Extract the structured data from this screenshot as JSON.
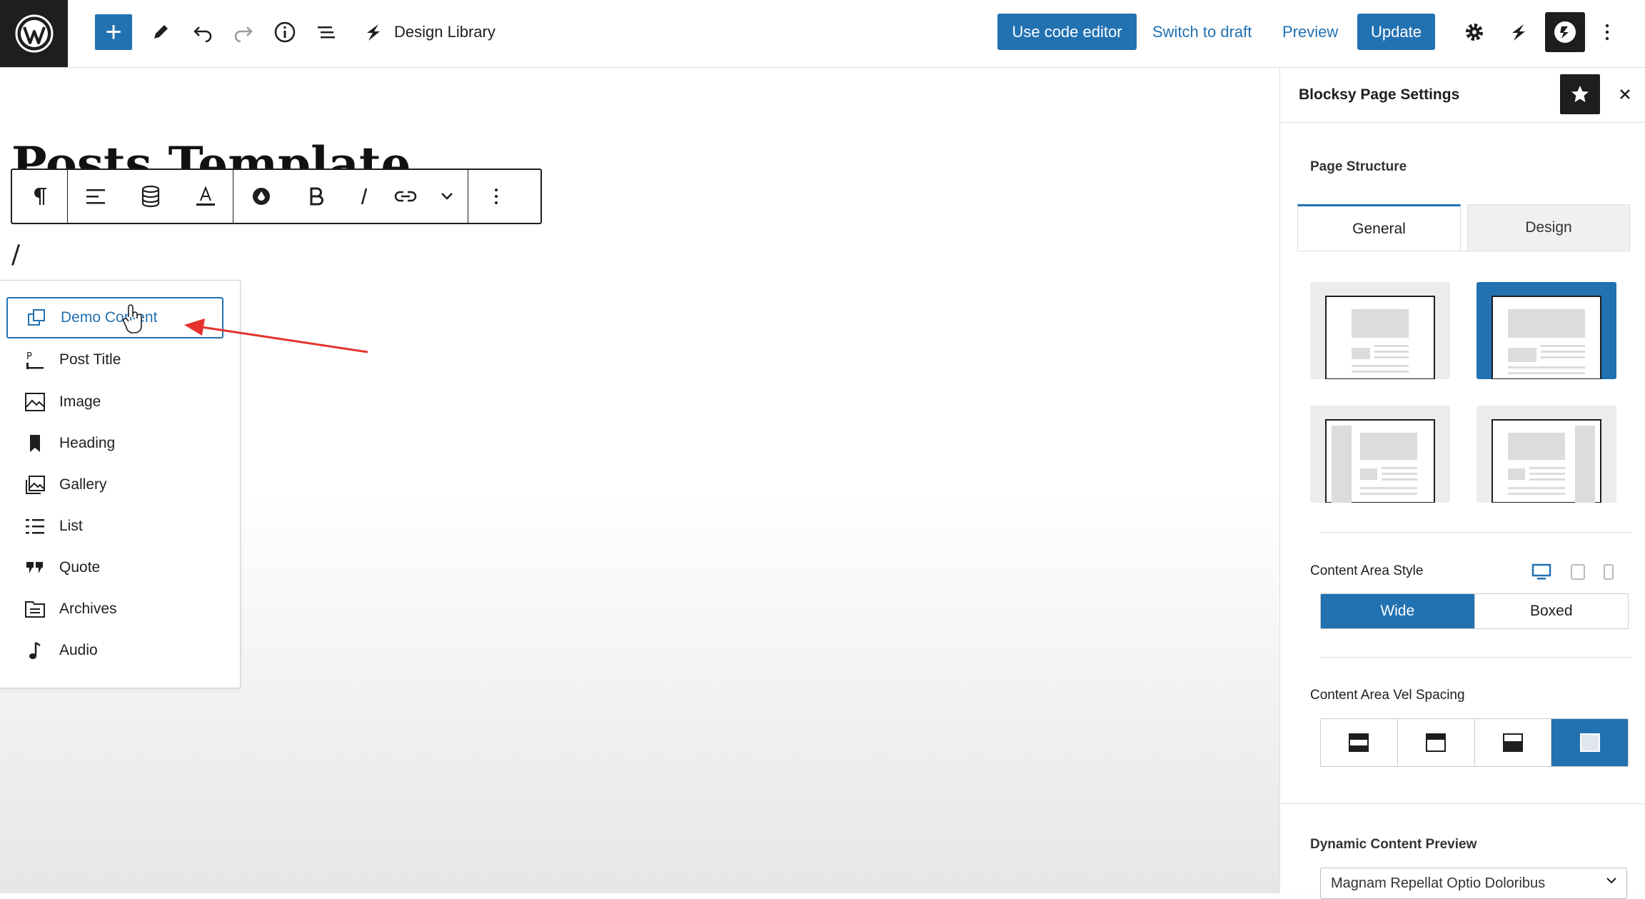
{
  "topbar": {
    "design_library_label": "Design Library",
    "code_editor_label": "Use code editor",
    "switch_draft_label": "Switch to draft",
    "preview_label": "Preview",
    "update_label": "Update",
    "accent_color": "#2271b1"
  },
  "editor": {
    "post_title": "Posts Template",
    "slash_input": "/",
    "toolbar": [
      "paragraph-icon",
      "align-icon",
      "database-icon",
      "text-color-icon",
      "highlight-icon",
      "bold-icon",
      "italic-icon",
      "link-icon",
      "more-chevron-icon",
      "options-icon"
    ]
  },
  "inserter": {
    "items": [
      {
        "label": "Demo Content",
        "icon": "demo-content-icon"
      },
      {
        "label": "Post Title",
        "icon": "post-title-icon"
      },
      {
        "label": "Image",
        "icon": "image-icon"
      },
      {
        "label": "Heading",
        "icon": "heading-icon"
      },
      {
        "label": "Gallery",
        "icon": "gallery-icon"
      },
      {
        "label": "List",
        "icon": "list-icon"
      },
      {
        "label": "Quote",
        "icon": "quote-icon"
      },
      {
        "label": "Archives",
        "icon": "archives-icon"
      },
      {
        "label": "Audio",
        "icon": "audio-icon"
      }
    ]
  },
  "sidebar": {
    "title": "Blocksy Page Settings",
    "page_structure_label": "Page Structure",
    "tabs": [
      {
        "label": "General"
      },
      {
        "label": "Design"
      }
    ],
    "content_area_style_label": "Content Area Style",
    "content_area_style_options": [
      "Wide",
      "Boxed"
    ],
    "vertical_spacing_label": "Content Area Vel Spacing",
    "dynamic_preview_label": "Dynamic Content Preview",
    "dynamic_preview_value": "Magnam Repellat Optio Doloribus"
  }
}
